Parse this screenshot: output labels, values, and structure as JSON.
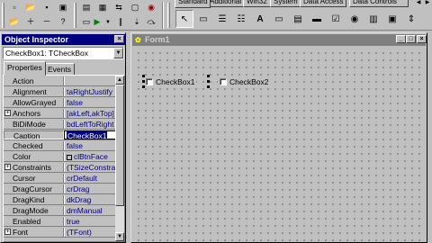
{
  "toolbar": {
    "left_icons": [
      "new-file-icon",
      "open-file-icon",
      "save-icon",
      "save-all-icon",
      "open-project-icon",
      "add-file-icon",
      "remove-file-icon",
      "help-icon",
      "view-unit-icon",
      "view-form-icon",
      "toggle-form-unit-icon",
      "new-form-icon",
      "run-icon",
      "run-dropdown-icon",
      "pause-icon",
      "trace-into-icon",
      "step-over-icon"
    ]
  },
  "palette": {
    "tabs": [
      "Standard",
      "Additional",
      "Win32",
      "System",
      "Data Access",
      "Data Controls"
    ],
    "active_tab": "Standard",
    "items": [
      "pointer-icon",
      "frames-icon",
      "main-menu-icon",
      "popup-menu-icon",
      "label-icon",
      "edit-icon",
      "memo-icon",
      "button-icon",
      "checkbox-icon",
      "radiobutton-icon",
      "listbox-icon",
      "combobox-icon"
    ]
  },
  "object_inspector": {
    "title": "Object Inspector",
    "selected_object": "CheckBox1: TCheckBox",
    "tabs": [
      "Properties",
      "Events"
    ],
    "active_tab": "Properties",
    "properties": [
      {
        "name": "Action",
        "value": "",
        "expandable": false
      },
      {
        "name": "Alignment",
        "value": "taRightJustify",
        "expandable": false
      },
      {
        "name": "AllowGrayed",
        "value": "false",
        "expandable": false
      },
      {
        "name": "Anchors",
        "value": "[akLeft,akTop]",
        "expandable": true
      },
      {
        "name": "BiDiMode",
        "value": "bdLeftToRight",
        "expandable": false
      },
      {
        "name": "Caption",
        "value": "CheckBox1",
        "expandable": false,
        "editing": true
      },
      {
        "name": "Checked",
        "value": "false",
        "expandable": false
      },
      {
        "name": "Color",
        "value": "clBtnFace",
        "expandable": false,
        "color": true
      },
      {
        "name": "Constraints",
        "value": "(TSizeConstrain",
        "expandable": true
      },
      {
        "name": "Cursor",
        "value": "crDefault",
        "expandable": false
      },
      {
        "name": "DragCursor",
        "value": "crDrag",
        "expandable": false
      },
      {
        "name": "DragKind",
        "value": "dkDrag",
        "expandable": false
      },
      {
        "name": "DragMode",
        "value": "dmManual",
        "expandable": false
      },
      {
        "name": "Enabled",
        "value": "true",
        "expandable": false
      },
      {
        "name": "Font",
        "value": "(TFont)",
        "expandable": true
      }
    ]
  },
  "form": {
    "title": "Form1",
    "checkboxes": [
      {
        "label": "CheckBox1",
        "selected": true
      },
      {
        "label": "CheckBox2",
        "selected": false
      }
    ]
  }
}
